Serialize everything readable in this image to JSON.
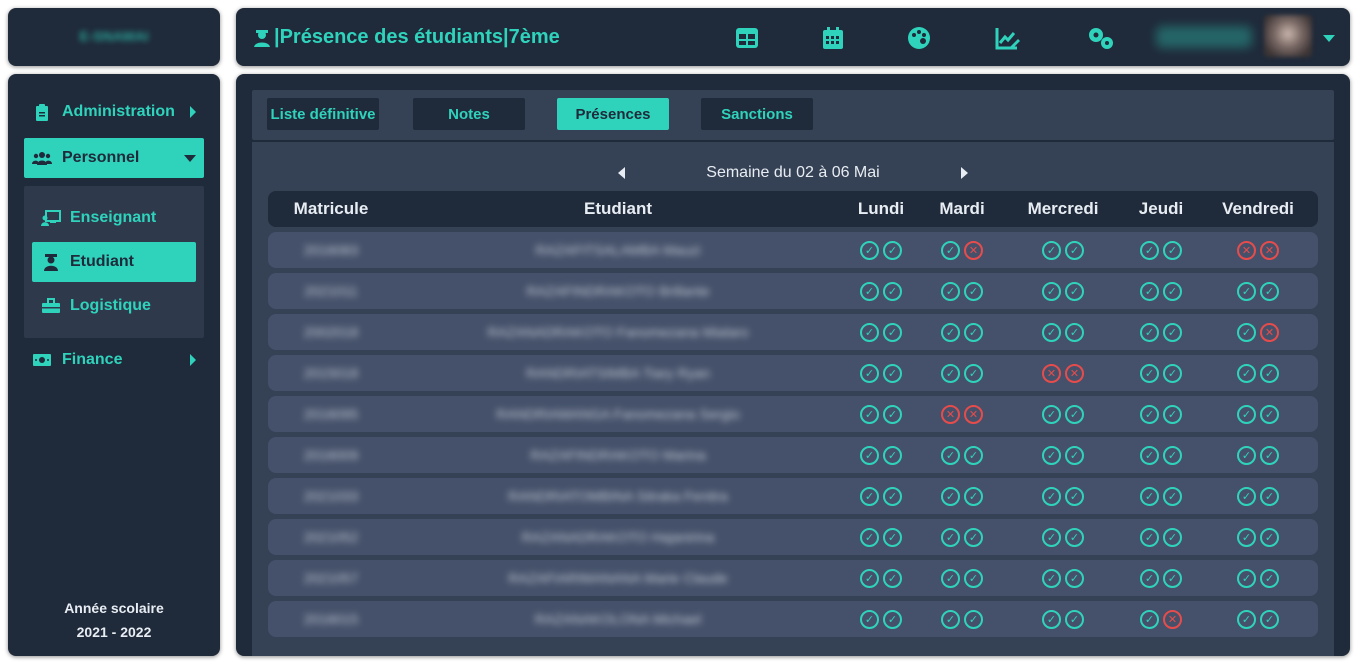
{
  "logo": {
    "text": "E-SNAMAI"
  },
  "header": {
    "title": "|Présence des étudiants|7ème",
    "icons": [
      "table-icon",
      "calendar-icon",
      "palette-icon",
      "chart-edit-icon",
      "gears-icon"
    ],
    "user_name": "Utilisateur"
  },
  "sidebar": {
    "items": [
      {
        "label": "Administration",
        "icon": "clipboard-icon"
      },
      {
        "label": "Personnel",
        "icon": "users-icon"
      },
      {
        "label": "Finance",
        "icon": "money-icon"
      }
    ],
    "subitems": [
      {
        "label": "Enseignant",
        "icon": "teacher-icon"
      },
      {
        "label": "Etudiant",
        "icon": "student-icon"
      },
      {
        "label": "Logistique",
        "icon": "toolbox-icon"
      }
    ],
    "school_year_label": "Année scolaire",
    "school_year_value": "2021 - 2022"
  },
  "tabs": [
    {
      "label": "Liste définitive"
    },
    {
      "label": "Notes"
    },
    {
      "label": "Présences"
    },
    {
      "label": "Sanctions"
    }
  ],
  "week": {
    "label": "Semaine du 02 à 06 Mai"
  },
  "table": {
    "columns": [
      "Matricule",
      "Etudiant",
      "Lundi",
      "Mardi",
      "Mercredi",
      "Jeudi",
      "Vendredi"
    ],
    "rows": [
      {
        "matricule": "2016083",
        "name": "RAZAFITSALAMBA Mauzi",
        "days": [
          [
            "ok",
            "ok"
          ],
          [
            "ok",
            "ko"
          ],
          [
            "ok",
            "ok"
          ],
          [
            "ok",
            "ok"
          ],
          [
            "ko",
            "ko"
          ]
        ]
      },
      {
        "matricule": "2021011",
        "name": "RAZAFINDRAKOTO Brillante",
        "days": [
          [
            "ok",
            "ok"
          ],
          [
            "ok",
            "ok"
          ],
          [
            "ok",
            "ok"
          ],
          [
            "ok",
            "ok"
          ],
          [
            "ok",
            "ok"
          ]
        ]
      },
      {
        "matricule": "2002018",
        "name": "RAZANADRAKOTO Fanomezana Mialaro",
        "days": [
          [
            "ok",
            "ok"
          ],
          [
            "ok",
            "ok"
          ],
          [
            "ok",
            "ok"
          ],
          [
            "ok",
            "ok"
          ],
          [
            "ok",
            "ko"
          ]
        ]
      },
      {
        "matricule": "2015018",
        "name": "RANDRIATSIMBA Tiary Ryan",
        "days": [
          [
            "ok",
            "ok"
          ],
          [
            "ok",
            "ok"
          ],
          [
            "ko",
            "ko"
          ],
          [
            "ok",
            "ok"
          ],
          [
            "ok",
            "ok"
          ]
        ]
      },
      {
        "matricule": "2016095",
        "name": "RANDRIAMANGA Fanomezana Sergio",
        "days": [
          [
            "ok",
            "ok"
          ],
          [
            "ko",
            "ko"
          ],
          [
            "ok",
            "ok"
          ],
          [
            "ok",
            "ok"
          ],
          [
            "ok",
            "ok"
          ]
        ]
      },
      {
        "matricule": "2016009",
        "name": "RAZAFINDRAKOTO Marina",
        "days": [
          [
            "ok",
            "ok"
          ],
          [
            "ok",
            "ok"
          ],
          [
            "ok",
            "ok"
          ],
          [
            "ok",
            "ok"
          ],
          [
            "ok",
            "ok"
          ]
        ]
      },
      {
        "matricule": "2021033",
        "name": "RANDRIATOMBINA Sitraka Fenitra",
        "days": [
          [
            "ok",
            "ok"
          ],
          [
            "ok",
            "ok"
          ],
          [
            "ok",
            "ok"
          ],
          [
            "ok",
            "ok"
          ],
          [
            "ok",
            "ok"
          ]
        ]
      },
      {
        "matricule": "2021052",
        "name": "RAZANADRAKOTO Hajanirina",
        "days": [
          [
            "ok",
            "ok"
          ],
          [
            "ok",
            "ok"
          ],
          [
            "ok",
            "ok"
          ],
          [
            "ok",
            "ok"
          ],
          [
            "ok",
            "ok"
          ]
        ]
      },
      {
        "matricule": "2021057",
        "name": "RAZAFIARIMANANA Marie Claude",
        "days": [
          [
            "ok",
            "ok"
          ],
          [
            "ok",
            "ok"
          ],
          [
            "ok",
            "ok"
          ],
          [
            "ok",
            "ok"
          ],
          [
            "ok",
            "ok"
          ]
        ]
      },
      {
        "matricule": "2016015",
        "name": "RAZANAKOLONA Michael",
        "days": [
          [
            "ok",
            "ok"
          ],
          [
            "ok",
            "ok"
          ],
          [
            "ok",
            "ok"
          ],
          [
            "ok",
            "ko"
          ],
          [
            "ok",
            "ok"
          ]
        ]
      }
    ]
  },
  "colors": {
    "accent": "#2fd3bc",
    "panel": "#1f2a3a",
    "absent": "#e74c4c"
  },
  "marks": {
    "ok": "✓",
    "ko": "✕"
  }
}
